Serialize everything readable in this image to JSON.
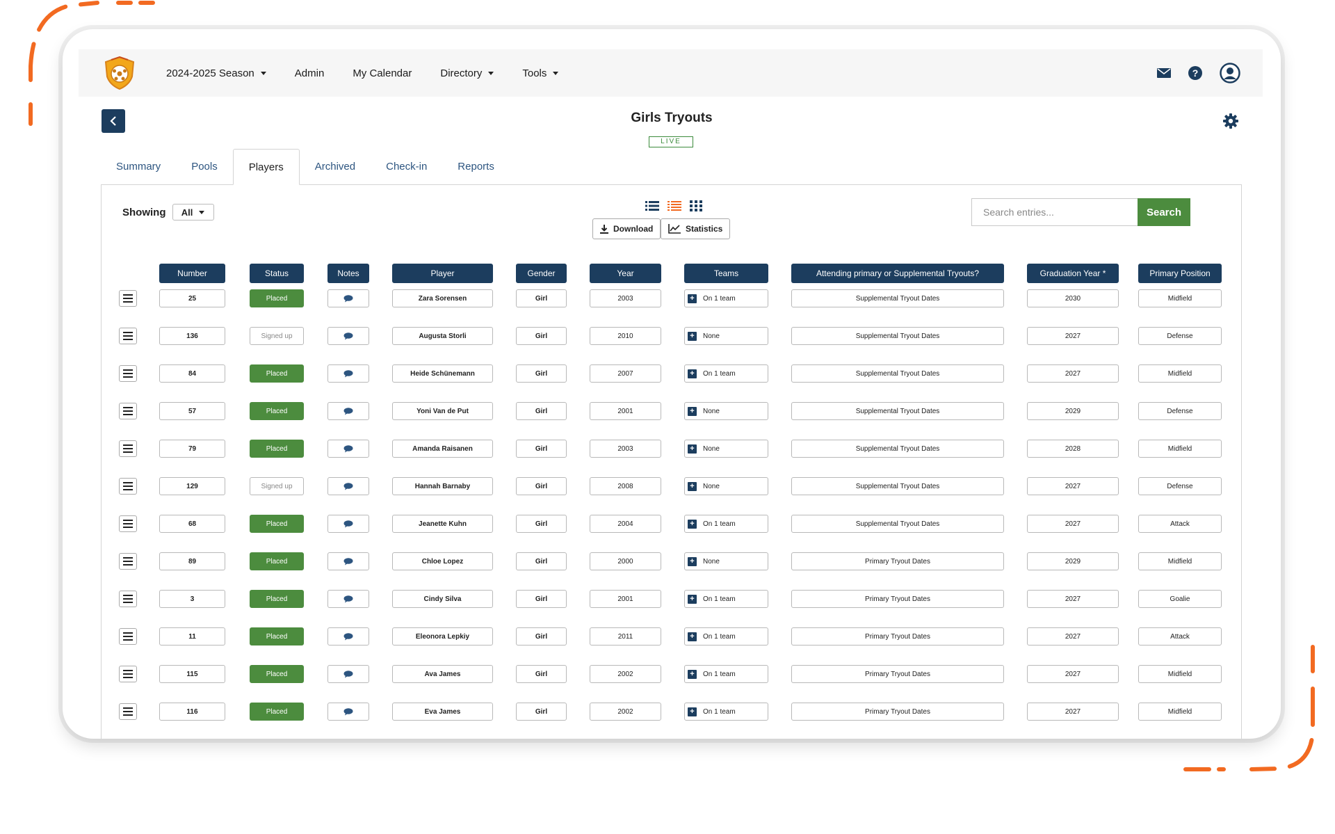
{
  "nav": {
    "season": "2024-2025 Season",
    "admin": "Admin",
    "calendar": "My Calendar",
    "directory": "Directory",
    "tools": "Tools"
  },
  "page": {
    "title": "Girls Tryouts",
    "badge": "LIVE"
  },
  "tabs": [
    "Summary",
    "Pools",
    "Players",
    "Archived",
    "Check-in",
    "Reports"
  ],
  "active_tab": "Players",
  "toolbar": {
    "showing_label": "Showing",
    "showing_value": "All",
    "download": "Download",
    "statistics": "Statistics",
    "search_placeholder": "Search entries...",
    "search_button": "Search"
  },
  "columns": [
    "Number",
    "Status",
    "Notes",
    "Player",
    "Gender",
    "Year",
    "Teams",
    "Attending primary or Supplemental Tryouts?",
    "Graduation Year *",
    "Primary Position"
  ],
  "rows": [
    {
      "number": "25",
      "status": "Placed",
      "player": "Zara Sorensen",
      "gender": "Girl",
      "year": "2003",
      "teams": "On 1 team",
      "attending": "Supplemental Tryout Dates",
      "grad": "2030",
      "position": "Midfield"
    },
    {
      "number": "136",
      "status": "Signed up",
      "player": "Augusta Storli",
      "gender": "Girl",
      "year": "2010",
      "teams": "None",
      "attending": "Supplemental Tryout Dates",
      "grad": "2027",
      "position": "Defense"
    },
    {
      "number": "84",
      "status": "Placed",
      "player": "Heide Schünemann",
      "gender": "Girl",
      "year": "2007",
      "teams": "On 1 team",
      "attending": "Supplemental Tryout Dates",
      "grad": "2027",
      "position": "Midfield"
    },
    {
      "number": "57",
      "status": "Placed",
      "player": "Yoni Van de Put",
      "gender": "Girl",
      "year": "2001",
      "teams": "None",
      "attending": "Supplemental Tryout Dates",
      "grad": "2029",
      "position": "Defense"
    },
    {
      "number": "79",
      "status": "Placed",
      "player": "Amanda Raisanen",
      "gender": "Girl",
      "year": "2003",
      "teams": "None",
      "attending": "Supplemental Tryout Dates",
      "grad": "2028",
      "position": "Midfield"
    },
    {
      "number": "129",
      "status": "Signed up",
      "player": "Hannah Barnaby",
      "gender": "Girl",
      "year": "2008",
      "teams": "None",
      "attending": "Supplemental Tryout Dates",
      "grad": "2027",
      "position": "Defense"
    },
    {
      "number": "68",
      "status": "Placed",
      "player": "Jeanette Kuhn",
      "gender": "Girl",
      "year": "2004",
      "teams": "On 1 team",
      "attending": "Supplemental Tryout Dates",
      "grad": "2027",
      "position": "Attack"
    },
    {
      "number": "89",
      "status": "Placed",
      "player": "Chloe Lopez",
      "gender": "Girl",
      "year": "2000",
      "teams": "None",
      "attending": "Primary Tryout Dates",
      "grad": "2029",
      "position": "Midfield"
    },
    {
      "number": "3",
      "status": "Placed",
      "player": "Cindy Silva",
      "gender": "Girl",
      "year": "2001",
      "teams": "On 1 team",
      "attending": "Primary Tryout Dates",
      "grad": "2027",
      "position": "Goalie"
    },
    {
      "number": "11",
      "status": "Placed",
      "player": "Eleonora Lepkiy",
      "gender": "Girl",
      "year": "2011",
      "teams": "On 1 team",
      "attending": "Primary Tryout Dates",
      "grad": "2027",
      "position": "Attack"
    },
    {
      "number": "115",
      "status": "Placed",
      "player": "Ava James",
      "gender": "Girl",
      "year": "2002",
      "teams": "On 1 team",
      "attending": "Primary Tryout Dates",
      "grad": "2027",
      "position": "Midfield"
    },
    {
      "number": "116",
      "status": "Placed",
      "player": "Eva James",
      "gender": "Girl",
      "year": "2002",
      "teams": "On 1 team",
      "attending": "Primary Tryout Dates",
      "grad": "2027",
      "position": "Midfield"
    }
  ],
  "colors": {
    "navy": "#1c3d5e",
    "green": "#4c8c3e",
    "accent_orange": "#f26a21",
    "link": "#2d5580"
  },
  "icons": {
    "logo": "shield-soccer-ball-logo",
    "mail": "envelope-icon",
    "help": "question-circle-icon",
    "account": "user-circle-icon",
    "back": "chevron-left-icon",
    "settings": "gear-icon",
    "views": [
      "list-view-icon",
      "detail-list-view-icon",
      "grid-view-icon"
    ],
    "notes": "speech-bubble-icon",
    "menu": "hamburger-menu-icon",
    "teams": "plus-square-icon"
  }
}
